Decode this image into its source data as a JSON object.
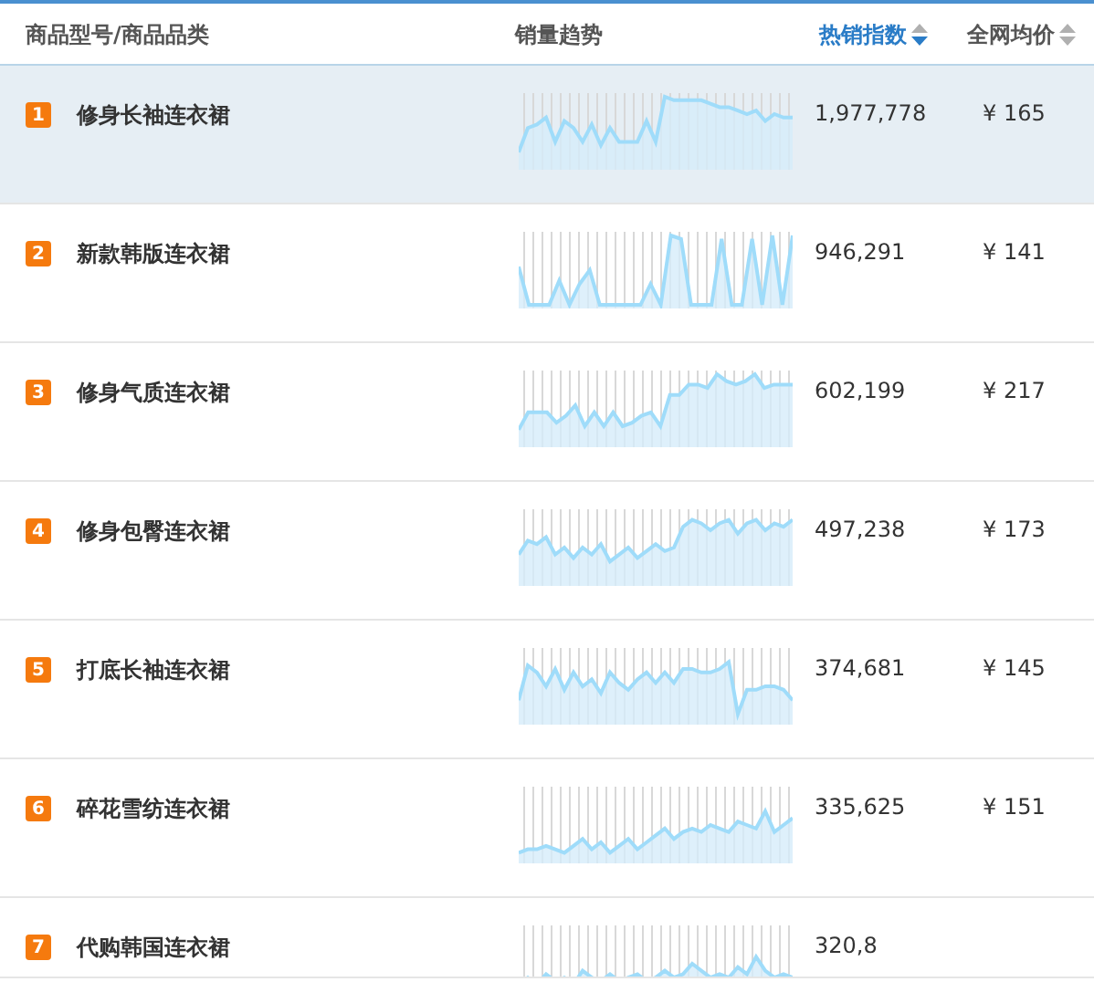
{
  "columns": [
    {
      "label": "商品型号/商品品类",
      "sortable": false,
      "sorted": false
    },
    {
      "label": "销量趋势",
      "sortable": false,
      "sorted": false
    },
    {
      "label": "热销指数",
      "sortable": true,
      "sorted": true
    },
    {
      "label": "全网均价",
      "sortable": true,
      "sorted": false
    }
  ],
  "rows": [
    {
      "rank": "1",
      "name": "修身长袖连衣裙",
      "index": "1,977,778",
      "price": "¥ 165",
      "selected": true
    },
    {
      "rank": "2",
      "name": "新款韩版连衣裙",
      "index": "946,291",
      "price": "¥ 141",
      "selected": false
    },
    {
      "rank": "3",
      "name": "修身气质连衣裙",
      "index": "602,199",
      "price": "¥ 217",
      "selected": false
    },
    {
      "rank": "4",
      "name": "修身包臀连衣裙",
      "index": "497,238",
      "price": "¥ 173",
      "selected": false
    },
    {
      "rank": "5",
      "name": "打底长袖连衣裙",
      "index": "374,681",
      "price": "¥ 145",
      "selected": false
    },
    {
      "rank": "6",
      "name": "碎花雪纺连衣裙",
      "index": "335,625",
      "price": "¥ 151",
      "selected": false
    },
    {
      "rank": "7",
      "name": "代购韩国连衣裙",
      "index": "320,8",
      "selected": false
    }
  ]
}
